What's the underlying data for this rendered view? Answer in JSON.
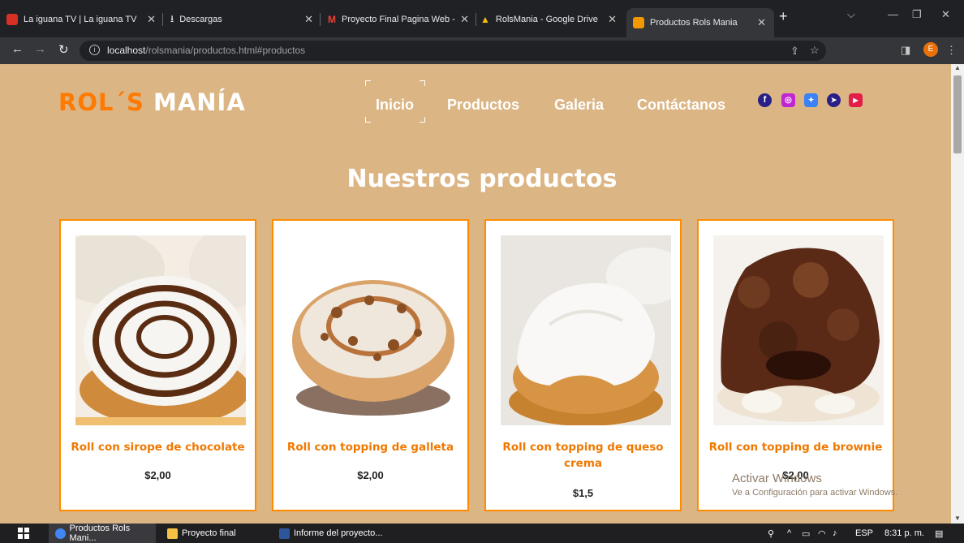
{
  "browser": {
    "tabs": [
      {
        "title": "La iguana TV | La iguana TV",
        "active": false,
        "fav_color": "#d93025"
      },
      {
        "title": "Descargas",
        "active": false,
        "fav_color": "#202124"
      },
      {
        "title": "Proyecto Final Pagina Web - ",
        "active": false,
        "fav_color": "#ea4335"
      },
      {
        "title": "RolsMania - Google Drive",
        "active": false,
        "fav_color": "#34a853"
      },
      {
        "title": "Productos Rols Mania",
        "active": true,
        "fav_color": "#f29900"
      }
    ],
    "url_host": "localhost",
    "url_path": "/rolsmania/productos.html#productos",
    "avatar_letter": "E"
  },
  "site": {
    "logo_part1": "ROL´S",
    "logo_part2": "MANÍA",
    "menu": [
      "Inicio",
      "Productos",
      "Galeria",
      "Contáctanos"
    ],
    "social": [
      {
        "icon": "facebook-icon",
        "color": "#2a1f86"
      },
      {
        "icon": "instagram-icon",
        "color": "#c026d3"
      },
      {
        "icon": "twitter-icon",
        "color": "#3b82f6"
      },
      {
        "icon": "telegram-icon",
        "color": "#2a1f86"
      },
      {
        "icon": "youtube-icon",
        "color": "#e11d48"
      }
    ],
    "section_title": "Nuestros productos",
    "products": [
      {
        "name": "Roll con sirope de chocolate",
        "price": "$2,00"
      },
      {
        "name": "Roll con topping de galleta",
        "price": "$2,00"
      },
      {
        "name": "Roll con topping de queso crema",
        "price": "$1,5"
      },
      {
        "name": "Roll con topping de brownie",
        "price": "$2,00"
      }
    ]
  },
  "watermark": {
    "line1": "Activar Windows",
    "line2": "Ve a Configuración para activar Windows."
  },
  "taskbar": {
    "items": [
      "Productos Rols Mani...",
      "Proyecto final",
      "Informe del proyecto..."
    ],
    "lang": "ESP",
    "time": "8:31 p. m."
  }
}
